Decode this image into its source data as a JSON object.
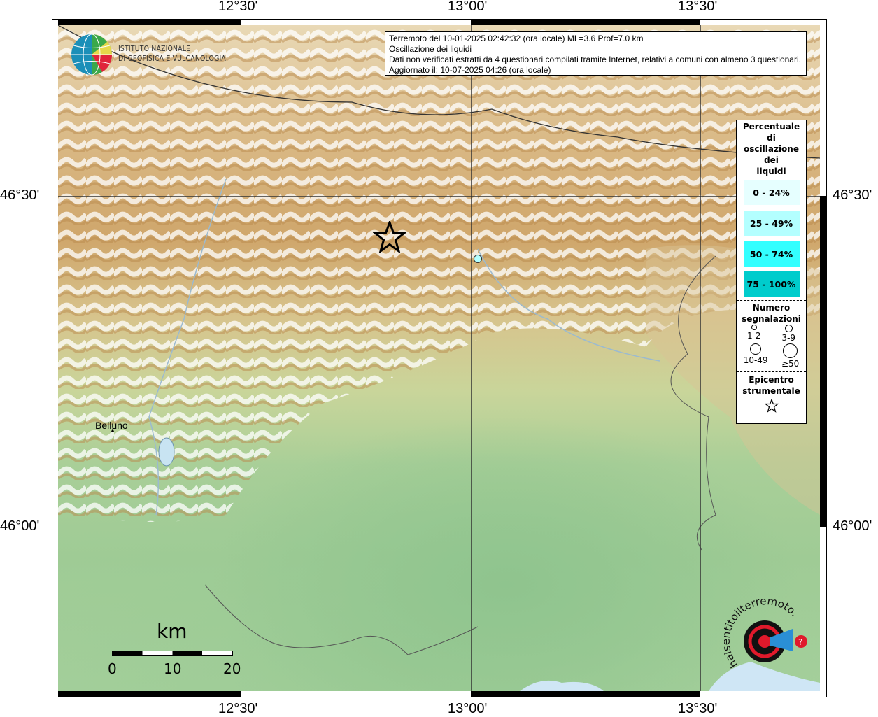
{
  "header": {
    "line1": "Terremoto del 10-01-2025 02:42:32 (ora locale) ML=3.6 Prof=7.0 km",
    "line2": "Oscillazione dei liquidi",
    "line3": "Dati non verificati estratti da 4 questionari compilati tramite Internet, relativi a comuni con almeno 3 questionari.",
    "line4": "Aggiornato il: 10-07-2025 04:26 (ora locale)"
  },
  "axes": {
    "top": [
      "12°30'",
      "13°00'",
      "13°30'"
    ],
    "bottom": [
      "12°30'",
      "13°00'",
      "13°30'"
    ],
    "left": [
      "46°30'",
      "46°00'"
    ],
    "right": [
      "46°30'",
      "46°00'"
    ]
  },
  "legend": {
    "title_lines": [
      "Percentuale",
      "di",
      "oscillazione",
      "dei",
      "liquidi"
    ],
    "classes": [
      {
        "label": "0 - 24%",
        "color": "#e6ffff"
      },
      {
        "label": "25 - 49%",
        "color": "#b3ffff"
      },
      {
        "label": "50 - 74%",
        "color": "#33ffff"
      },
      {
        "label": "75 - 100%",
        "color": "#00cccc"
      }
    ],
    "count_title_lines": [
      "Numero",
      "segnalazioni"
    ],
    "count_classes": [
      "1-2",
      "3-9",
      "10-49",
      "≥50"
    ],
    "epicenter_lines": [
      "Epicentro",
      "strumentale"
    ]
  },
  "places": [
    {
      "name": "Belluno"
    }
  ],
  "observations": [
    {
      "percent_class": "25 - 49%",
      "count_class": "1-2",
      "color": "#b3ffff"
    }
  ],
  "epicenter": {
    "symbol": "star"
  },
  "scale_bar": {
    "unit": "km",
    "labels": [
      "0",
      "10",
      "20"
    ]
  },
  "logos": {
    "ingv_line1": "ISTITUTO NAZIONALE",
    "ingv_line2": "DI GEOFISICA E VULCANOLOGIA",
    "hsit": "www.haisentitoilterremoto.it"
  }
}
